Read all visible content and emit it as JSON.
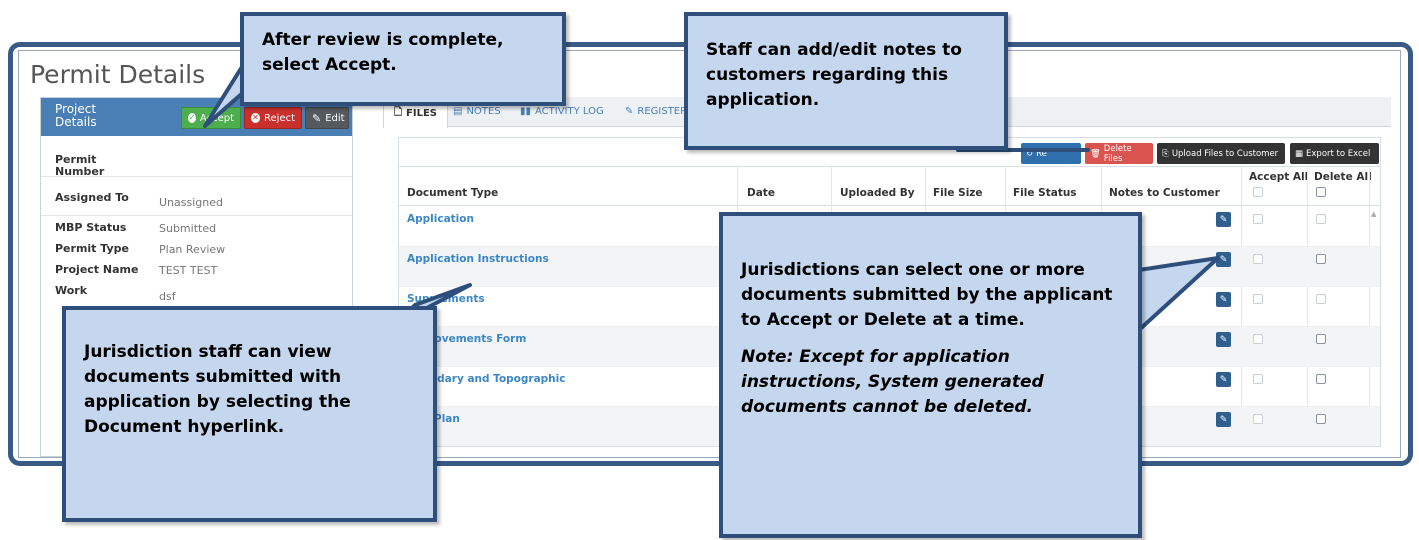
{
  "page": {
    "title": "Permit Details"
  },
  "left_panel": {
    "header_title": "Project Details",
    "buttons": {
      "accept": "Accept",
      "reject": "Reject",
      "edit": "Edit"
    },
    "fields": [
      {
        "label": "Permit Number",
        "value": ""
      },
      {
        "label": "Assigned To",
        "value": "Unassigned"
      },
      {
        "label": "MBP Status",
        "value": "Submitted"
      },
      {
        "label": "Permit Type",
        "value": "Plan Review"
      },
      {
        "label": "Project Name",
        "value": "TEST TEST"
      },
      {
        "label": "Work",
        "value": "dsf"
      }
    ]
  },
  "tabs": [
    {
      "label": "FILES",
      "icon": "files-icon",
      "active": true
    },
    {
      "label": "NOTES",
      "icon": "notes-icon"
    },
    {
      "label": "ACTIVITY LOG",
      "icon": "activity-log-icon"
    },
    {
      "label": "REGISTER",
      "icon": "register-icon"
    }
  ],
  "toolbar": {
    "refresh": "Re",
    "delete_files": "Delete Files",
    "upload": "Upload Files to Customer",
    "export": "Export to Excel"
  },
  "table": {
    "headers": {
      "document_type": "Document Type",
      "date": "Date",
      "uploaded_by": "Uploaded By",
      "file_size": "File Size",
      "file_status": "File Status",
      "notes": "Notes to Customer",
      "accept_all": "Accept All",
      "delete_all": "Delete All"
    },
    "rows": [
      {
        "document": "Application",
        "delete_enabled": false
      },
      {
        "document": "Application Instructions",
        "delete_enabled": true
      },
      {
        "document": "Supplements",
        "delete_enabled": false
      },
      {
        "document": "Improvements Form",
        "delete_enabled": true
      },
      {
        "document": "Boundary and Topographic",
        "delete_enabled": true
      },
      {
        "document": "ural Plan",
        "delete_enabled": true
      }
    ]
  },
  "callouts": {
    "accept": "After review is complete, select Accept.",
    "notes": "Staff can add/edit notes to customers regarding this application.",
    "documents": "Jurisdiction staff can view documents submitted with application by selecting the Document hyperlink.",
    "select": "Jurisdictions can select one or more documents submitted by the applicant to Accept or Delete at a time.",
    "note": "Note: Except for application instructions, System generated documents cannot be deleted."
  },
  "colors": {
    "frame": "#3a5a86",
    "callout_fill": "#c5d7ee",
    "header_blue": "#4a7fb6",
    "accept_green": "#4cae4c",
    "reject_red": "#c9302c",
    "link_blue": "#3a87c8"
  }
}
